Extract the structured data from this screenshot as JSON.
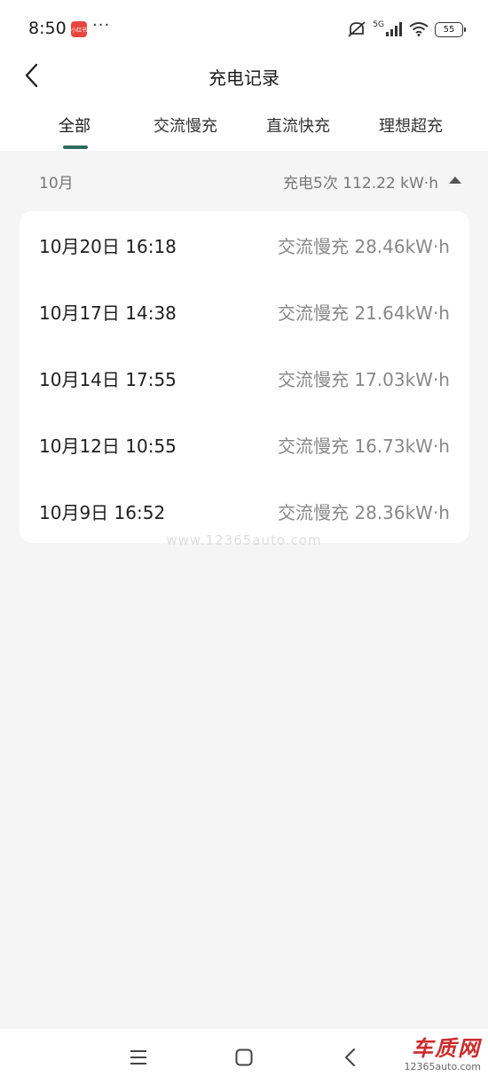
{
  "status_bar": {
    "time": "8:50",
    "app_badge": "小红书",
    "more": "···",
    "network": "5G",
    "battery": "55"
  },
  "header": {
    "title": "充电记录"
  },
  "tabs": [
    {
      "label": "全部",
      "active": true
    },
    {
      "label": "交流慢充",
      "active": false
    },
    {
      "label": "直流快充",
      "active": false
    },
    {
      "label": "理想超充",
      "active": false
    }
  ],
  "month_group": {
    "month": "10月",
    "summary": "充电5次 112.22  kW·h"
  },
  "records": [
    {
      "datetime": "10月20日 16:18",
      "detail": "交流慢充 28.46kW·h"
    },
    {
      "datetime": "10月17日 14:38",
      "detail": "交流慢充 21.64kW·h"
    },
    {
      "datetime": "10月14日 17:55",
      "detail": "交流慢充 17.03kW·h"
    },
    {
      "datetime": "10月12日 10:55",
      "detail": "交流慢充 16.73kW·h"
    },
    {
      "datetime": "10月9日 16:52",
      "detail": "交流慢充 28.36kW·h"
    }
  ],
  "watermark": {
    "text": "www.12365auto.com",
    "logo_cn": "车质网",
    "logo_en": "12365auto.com"
  },
  "colors": {
    "accent": "#2c6e5d",
    "background": "#f5f5f5",
    "card": "#ffffff"
  }
}
